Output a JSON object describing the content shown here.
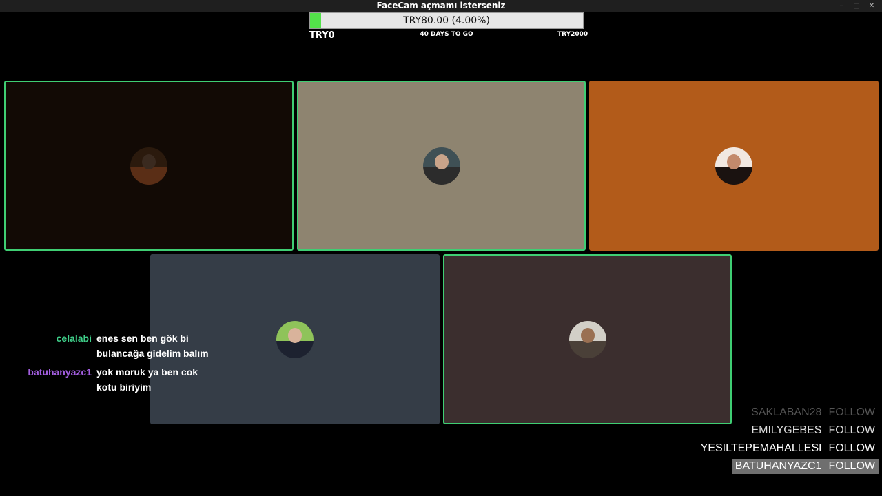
{
  "window": {
    "title": "FaceCam açmamı isterseniz",
    "minimize": "–",
    "maximize": "□",
    "close": "✕"
  },
  "goal": {
    "label": "TRY80.00 (4.00%)",
    "min": "TRY0",
    "days": "40 DAYS TO GO",
    "max": "TRY2000",
    "progress": 0.04,
    "fill_color": "#53e24a"
  },
  "tiles": [
    {
      "bg": "#120a05",
      "speaking": true,
      "avatar_top": "#2b1a0d",
      "avatar_bot": "#5a2e16",
      "head": "#3a2a1f"
    },
    {
      "bg": "#8e8470",
      "speaking": true,
      "avatar_top": "#3f5055",
      "avatar_bot": "#2c2c2c",
      "head": "#c9a48a"
    },
    {
      "bg": "#b25b1a",
      "speaking": false,
      "avatar_top": "#f1e8e1",
      "avatar_bot": "#1a1210",
      "head": "#c38a6c"
    },
    {
      "bg": "#353d47",
      "speaking": false,
      "avatar_top": "#8fc35a",
      "avatar_bot": "#1d2230",
      "head": "#d9b39b"
    },
    {
      "bg": "#3b2e2e",
      "speaking": true,
      "avatar_top": "#d2cfc7",
      "avatar_bot": "#4a4038",
      "head": "#9a7052"
    }
  ],
  "chat": [
    {
      "user": "celalabi",
      "color": "#3fd08a",
      "message": "enes sen ben gök bi bulancağa gidelim balım"
    },
    {
      "user": "batuhanyazc1",
      "color": "#a35ee0",
      "message": "yok moruk ya ben cok kotu biriyim"
    }
  ],
  "follows": [
    {
      "name": "SAKLABAN28",
      "action": "FOLLOW",
      "style": "dim"
    },
    {
      "name": "EMILYGEBES",
      "action": "FOLLOW",
      "style": "mid"
    },
    {
      "name": "YESILTEPEMAHALLESI",
      "action": "FOLLOW",
      "style": "bright"
    },
    {
      "name": "BATUHANYAZC1",
      "action": "FOLLOW",
      "style": "hl"
    }
  ]
}
